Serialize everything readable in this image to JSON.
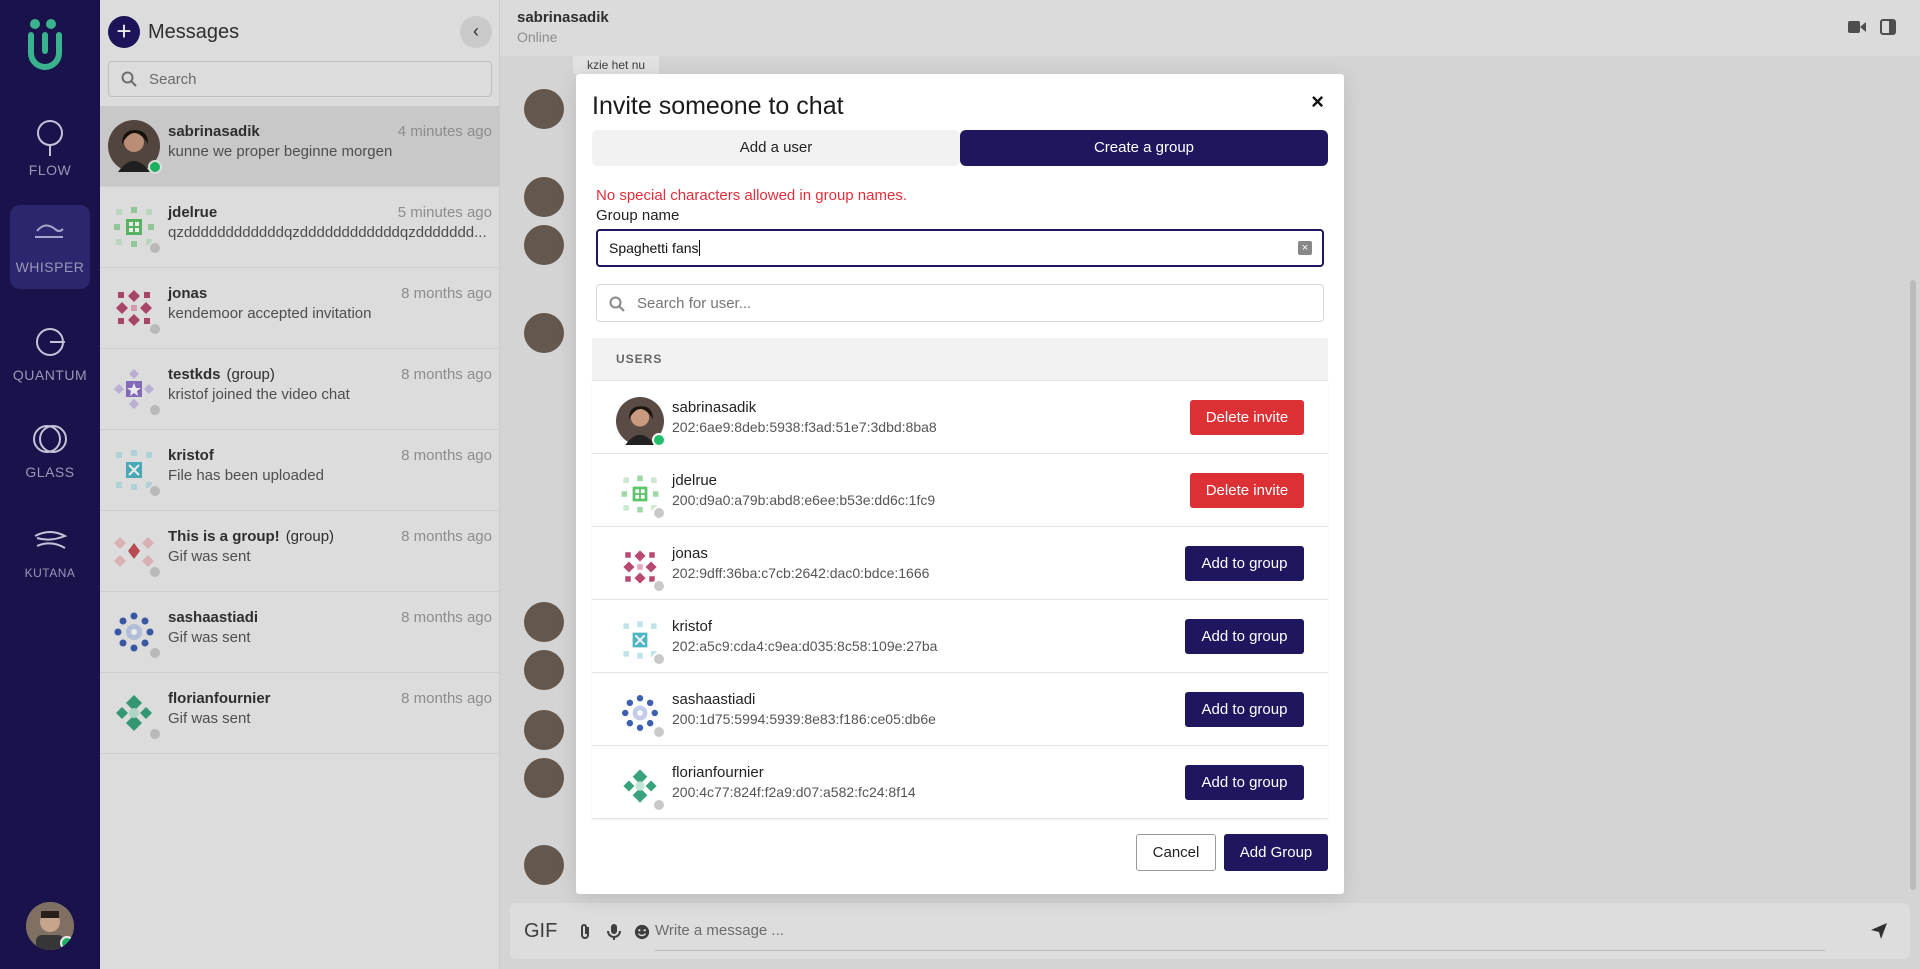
{
  "nav": {
    "items": [
      {
        "label": "FLOW",
        "icon": "flow-icon"
      },
      {
        "label": "WHISPER",
        "icon": "whisper-icon"
      },
      {
        "label": "QUANTUM",
        "icon": "quantum-icon"
      },
      {
        "label": "GLASS",
        "icon": "glass-icon"
      },
      {
        "label": "KUTANA",
        "icon": "kutana-icon"
      }
    ],
    "active": "WHISPER"
  },
  "sidebar": {
    "title": "Messages",
    "search_placeholder": "Search",
    "chats": [
      {
        "name": "sabrinasadik",
        "tag": "",
        "time": "4 minutes ago",
        "message": "kunne we proper beginne morgen",
        "online": true
      },
      {
        "name": "jdelrue",
        "tag": "",
        "time": "5 minutes ago",
        "message": "qzddddddddddddqzddddddddddddqzddddddd...",
        "online": false
      },
      {
        "name": "jonas",
        "tag": "",
        "time": "8 months ago",
        "message": "kendemoor accepted invitation",
        "online": false
      },
      {
        "name": "testkds",
        "tag": "(group)",
        "time": "8 months ago",
        "message": "kristof joined the video chat",
        "online": false
      },
      {
        "name": "kristof",
        "tag": "",
        "time": "8 months ago",
        "message": "File has been uploaded",
        "online": false
      },
      {
        "name": "This is a group!",
        "tag": "(group)",
        "time": "8 months ago",
        "message": "Gif was sent",
        "online": false
      },
      {
        "name": "sashaastiadi",
        "tag": "",
        "time": "8 months ago",
        "message": "Gif was sent",
        "online": false
      },
      {
        "name": "florianfournier",
        "tag": "",
        "time": "8 months ago",
        "message": "Gif was sent",
        "online": false
      }
    ]
  },
  "main": {
    "contact_name": "sabrinasadik",
    "contact_status": "Online",
    "peek_text": "kzie het nu",
    "composer": {
      "gif_label": "GIF",
      "placeholder": "Write a message ..."
    }
  },
  "modal": {
    "title": "Invite someone to chat",
    "close_label": "×",
    "tabs": {
      "add_user": "Add a user",
      "create_group": "Create a group"
    },
    "error": "No special characters allowed in group names.",
    "group_name_label": "Group name",
    "group_name_value": "Spaghetti fans",
    "user_search_placeholder": "Search for user...",
    "users_header": "USERS",
    "users": [
      {
        "name": "sabrinasadik",
        "address": "202:6ae9:8deb:5938:f3ad:51e7:3dbd:8ba8",
        "action": "Delete invite",
        "online": true
      },
      {
        "name": "jdelrue",
        "address": "200:d9a0:a79b:abd8:e6ee:b53e:dd6c:1fc9",
        "action": "Delete invite",
        "online": false
      },
      {
        "name": "jonas",
        "address": "202:9dff:36ba:c7cb:2642:dac0:bdce:1666",
        "action": "Add to group",
        "online": false
      },
      {
        "name": "kristof",
        "address": "202:a5c9:cda4:c9ea:d035:8c58:109e:27ba",
        "action": "Add to group",
        "online": false
      },
      {
        "name": "sashaastiadi",
        "address": "200:1d75:5994:5939:8e83:f186:ce05:db6e",
        "action": "Add to group",
        "online": false
      },
      {
        "name": "florianfournier",
        "address": "200:4c77:824f:f2a9:d07:a582:fc24:8f14",
        "action": "Add to group",
        "online": false
      }
    ],
    "cancel_label": "Cancel",
    "submit_label": "Add Group"
  },
  "colors": {
    "brand": "#1f1660",
    "nav_bg": "#1c1452",
    "danger": "#dc3034",
    "error_text": "#e02f3a",
    "online": "#1fbf6b",
    "logo": "#3ec39a"
  }
}
